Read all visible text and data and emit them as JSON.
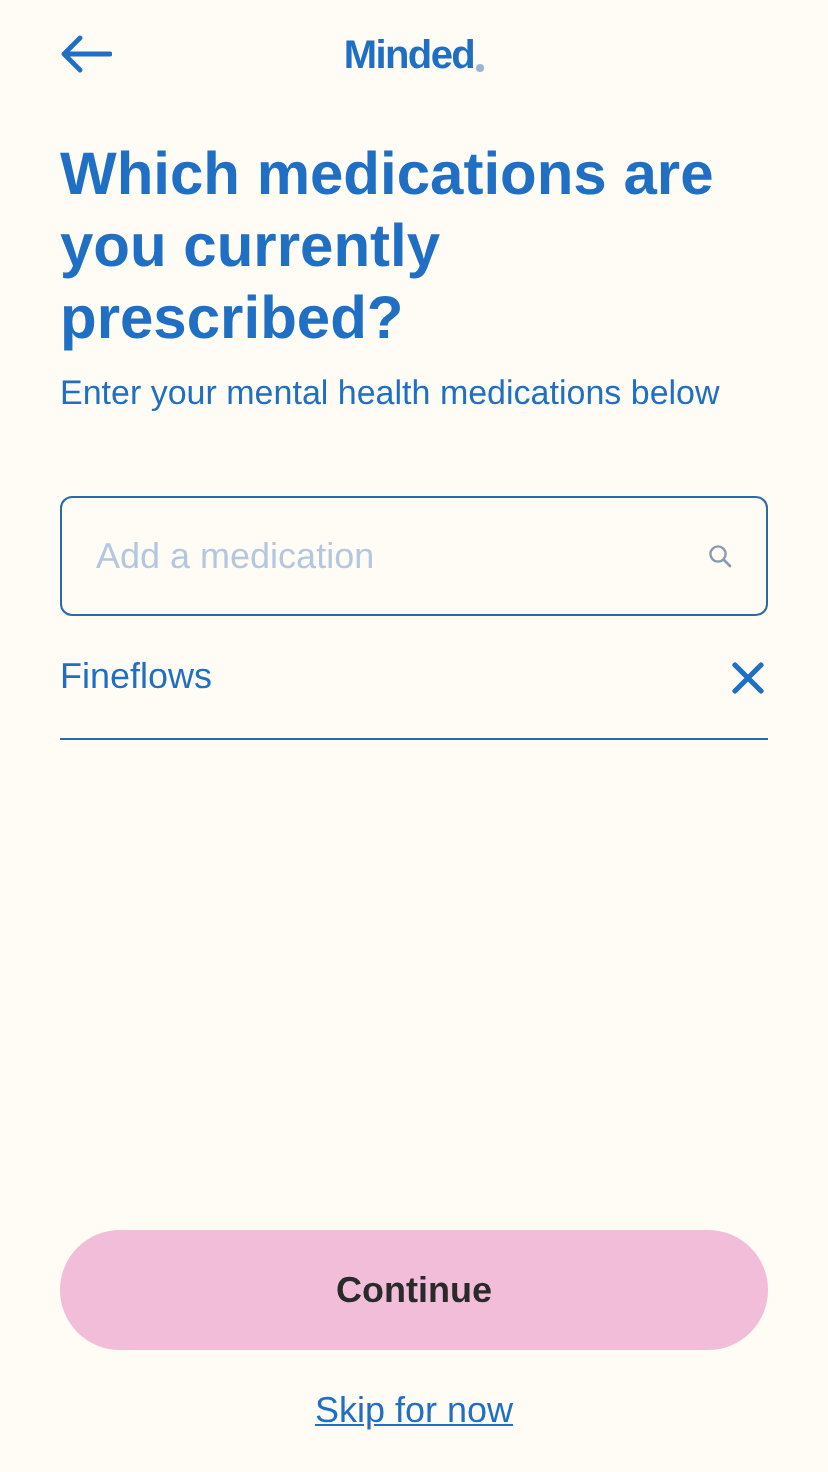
{
  "header": {
    "logo": "Minded"
  },
  "title": "Which medications are you currently prescribed?",
  "subtitle": "Enter your mental health medications below",
  "search": {
    "placeholder": "Add a medication"
  },
  "medications": [
    {
      "name": "Fineflows"
    }
  ],
  "continue_button": {
    "label": "Continue",
    "disabled": true
  },
  "skip_link": "Skip for now"
}
